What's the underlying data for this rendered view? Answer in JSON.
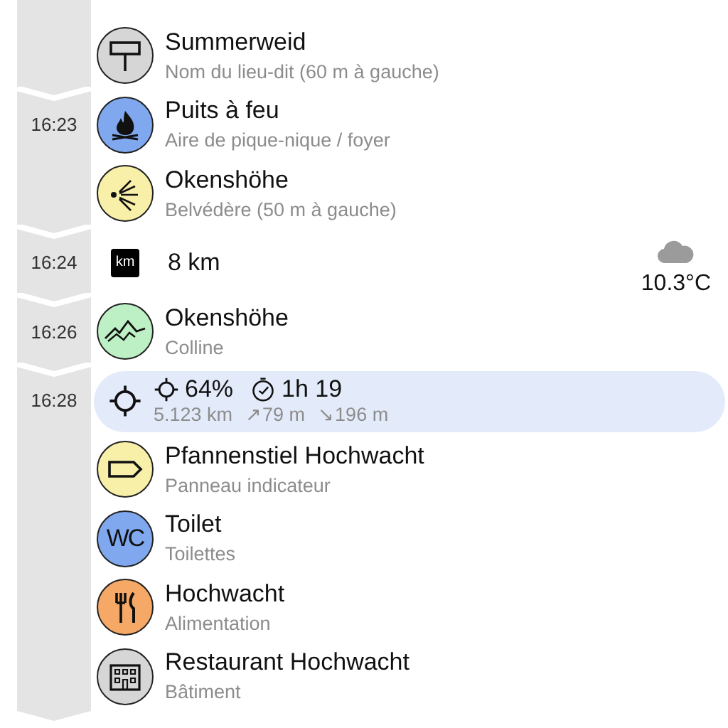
{
  "rows": [
    {
      "kind": "placename",
      "color": "#d6d6d6",
      "title": "Summerweid",
      "subtitle": "Nom du lieu-dit (60 m à gauche)"
    },
    {
      "kind": "firepit",
      "time": "16:23",
      "color": "#7fa8ee",
      "title": "Puits à feu",
      "subtitle": "Aire de pique-nique / foyer"
    },
    {
      "kind": "viewpoint",
      "color": "#f8f0a8",
      "title": "Okenshöhe",
      "subtitle": "Belvédère (50 m à gauche)"
    },
    {
      "kind": "distance",
      "time": "16:24",
      "badge": "km",
      "title": "8 km",
      "weather": {
        "temperature": "10.3°C"
      }
    },
    {
      "kind": "hill",
      "time": "16:26",
      "color": "#bdf0c4",
      "title": "Okenshöhe",
      "subtitle": "Colline"
    },
    {
      "kind": "position",
      "time": "16:28",
      "selected": true,
      "progress": "64%",
      "duration": "1h 19",
      "stats": [
        "5.123 km",
        "↗79 m",
        "↘196 m"
      ]
    },
    {
      "kind": "signpost",
      "color": "#f8f0a8",
      "title": "Pfannenstiel Hochwacht",
      "subtitle": "Panneau indicateur"
    },
    {
      "kind": "toilet",
      "icon_text": "WC",
      "color": "#7fa8ee",
      "title": "Toilet",
      "subtitle": "Toilettes"
    },
    {
      "kind": "food",
      "color": "#f6a866",
      "title": "Hochwacht",
      "subtitle": "Alimentation"
    },
    {
      "kind": "building",
      "color": "#d6d6d6",
      "title": "Restaurant Hochwacht",
      "subtitle": "Bâtiment"
    }
  ]
}
